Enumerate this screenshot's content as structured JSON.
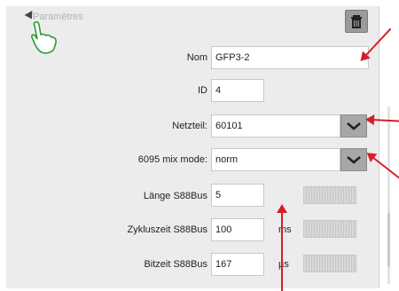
{
  "section": {
    "title": "Paramètres"
  },
  "fields": {
    "nom_label": "Nom",
    "nom_value": "GFP3-2",
    "id_label": "ID",
    "id_value": "4",
    "netzteil_label": "Netzteil:",
    "netzteil_value": "60101",
    "mix_label": "6095 mix mode:",
    "mix_value": "norm",
    "laenge_label": "Länge S88Bus",
    "laenge_value": "5",
    "zyklus_label": "Zykluszeit S88Bus",
    "zyklus_value": "100",
    "zyklus_unit": "ms",
    "bitzeit_label": "Bitzeit S88Bus",
    "bitzeit_value": "167",
    "bitzeit_unit": "µs"
  },
  "icons": {
    "collapse": "triangle-down-icon",
    "hand": "hand-pointer-icon",
    "trash": "trash-icon",
    "chevron": "chevron-down-icon"
  },
  "colors": {
    "accent_red": "#d61f26",
    "hand_green": "#2e9a3a",
    "panel_bg": "#ececec"
  }
}
